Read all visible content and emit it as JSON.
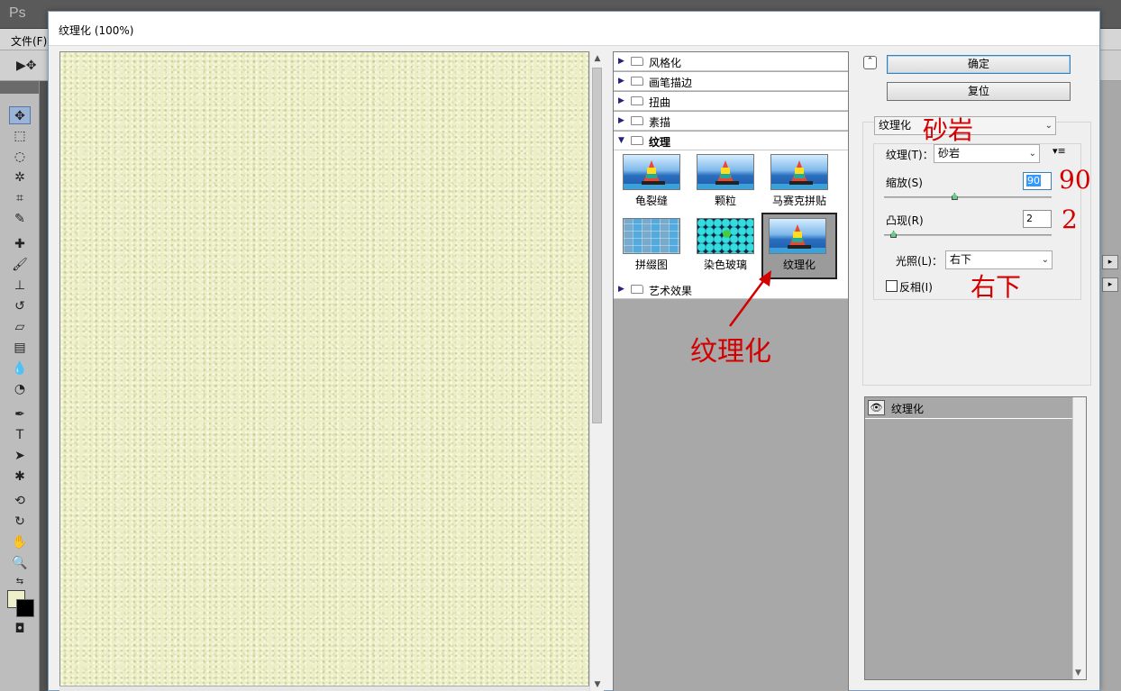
{
  "app": {
    "logo": "Ps",
    "menu_first": "文件(F)"
  },
  "dialog": {
    "title": "纹理化 (100%)"
  },
  "gallery": {
    "categories": [
      {
        "label": "风格化"
      },
      {
        "label": "画笔描边"
      },
      {
        "label": "扭曲"
      },
      {
        "label": "素描"
      },
      {
        "label": "纹理"
      },
      {
        "label": "艺术效果"
      }
    ],
    "thumbs": [
      {
        "label": "龟裂缝"
      },
      {
        "label": "颗粒"
      },
      {
        "label": "马赛克拼贴"
      },
      {
        "label": "拼缀图"
      },
      {
        "label": "染色玻璃"
      },
      {
        "label": "纹理化"
      }
    ]
  },
  "buttons": {
    "ok": "确定",
    "reset": "复位"
  },
  "settings": {
    "filter_select": "纹理化",
    "texture_label": "纹理(T)：",
    "texture_value": "砂岩",
    "scale_label": "缩放(S)",
    "scale_value": "90",
    "scale_fraction": 0.42,
    "relief_label": "凸现(R)",
    "relief_value": "2",
    "relief_fraction": 0.04,
    "light_label": "光照(L)：",
    "light_value": "右下",
    "invert_label": "反相(I)",
    "invert_checked": false
  },
  "layers": {
    "rows": [
      {
        "label": "纹理化"
      }
    ]
  },
  "annotations": {
    "texture": "砂岩",
    "scale": "90",
    "relief": "2",
    "light": "右下",
    "filter": "纹理化"
  },
  "colors": {
    "preview_fill": "#ecefc4",
    "annotation": "#d40000",
    "selection": "#3399ff"
  }
}
